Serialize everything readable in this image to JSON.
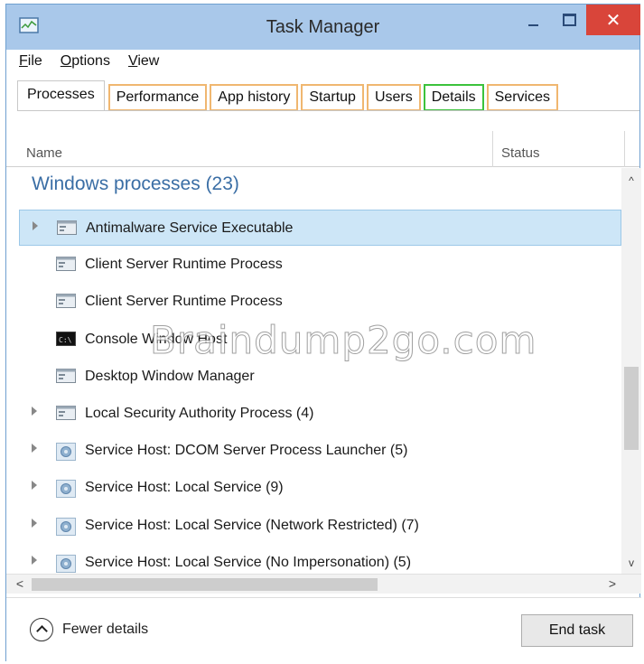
{
  "window": {
    "title": "Task Manager",
    "close_glyph": "✕"
  },
  "menu": [
    "File",
    "Options",
    "View"
  ],
  "tabs": [
    "Processes",
    "Performance",
    "App history",
    "Startup",
    "Users",
    "Details",
    "Services"
  ],
  "columns": {
    "name": "Name",
    "status": "Status"
  },
  "group": {
    "title": "Windows processes (23)"
  },
  "processes": [
    {
      "label": "Antimalware Service Executable",
      "icon": "window-process-icon",
      "expandable": true,
      "selected": true
    },
    {
      "label": "Client Server Runtime Process",
      "icon": "window-process-icon",
      "expandable": false
    },
    {
      "label": "Client Server Runtime Process",
      "icon": "window-process-icon",
      "expandable": false
    },
    {
      "label": "Console Window Host",
      "icon": "console-icon",
      "expandable": false
    },
    {
      "label": "Desktop Window Manager",
      "icon": "window-process-icon",
      "expandable": false
    },
    {
      "label": "Local Security Authority Process (4)",
      "icon": "window-process-icon",
      "expandable": true
    },
    {
      "label": "Service Host: DCOM Server Process Launcher (5)",
      "icon": "gear-icon",
      "expandable": true
    },
    {
      "label": "Service Host: Local Service (9)",
      "icon": "gear-icon",
      "expandable": true
    },
    {
      "label": "Service Host: Local Service (Network Restricted) (7)",
      "icon": "gear-icon",
      "expandable": true
    },
    {
      "label": "Service Host: Local Service (No Impersonation) (5)",
      "icon": "gear-icon",
      "expandable": true
    }
  ],
  "scroll": {
    "up": "^",
    "down": "v",
    "left": "<",
    "right": ">"
  },
  "footer": {
    "fewer_details": "Fewer details",
    "end_task": "End task"
  },
  "watermark": "Braindump2go.com",
  "colors": {
    "titlebar": "#a9c8ea",
    "close": "#d9453a",
    "tab_highlight": "#f0b770",
    "details_highlight": "#3cc23c",
    "group_title": "#3a6ea5",
    "selected_row": "#cde6f7"
  }
}
